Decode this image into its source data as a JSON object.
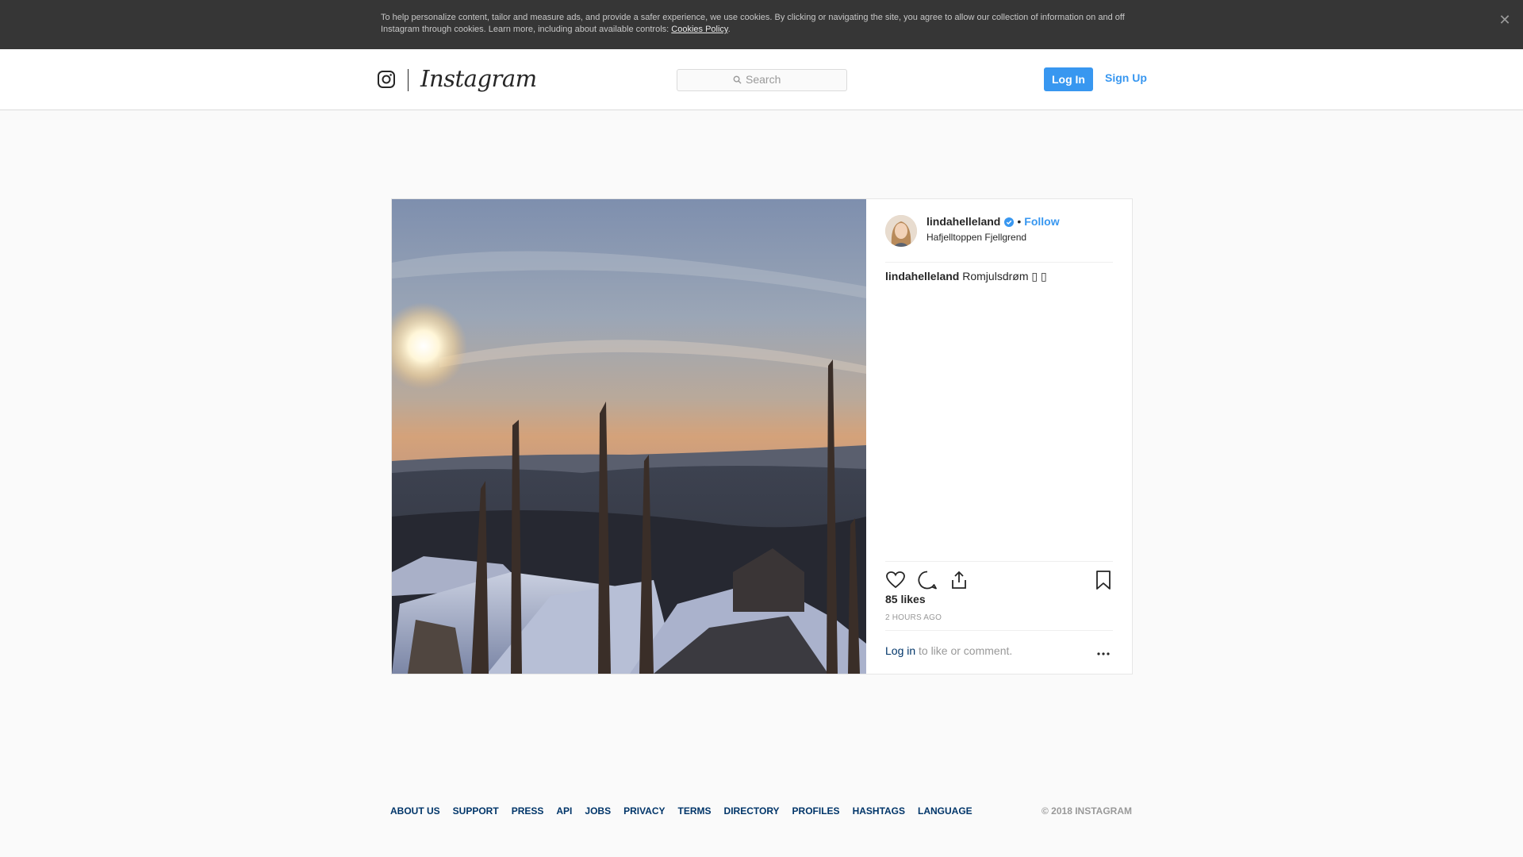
{
  "cookie_banner": {
    "text": "To help personalize content, tailor and measure ads, and provide a safer experience, we use cookies. By clicking or navigating the site, you agree to allow our collection of information on and off Instagram through cookies. Learn more, including about available controls: ",
    "link": "Cookies Policy",
    "end": ".",
    "close_icon": "close-icon"
  },
  "header": {
    "logo_text": "Instagram",
    "search_placeholder": "Search",
    "login_label": "Log In",
    "signup_label": "Sign Up"
  },
  "post": {
    "username": "lindahelleland",
    "verified": true,
    "separator": "•",
    "follow_label": "Follow",
    "location": "Hafjelltoppen Fjellgrend",
    "caption_user": "lindahelleland",
    "caption_text": "Romjulsdrøm ▯ ▯",
    "likes": "85 likes",
    "time": "2 HOURS AGO",
    "login_link": "Log in",
    "login_rest": "to like or comment.",
    "icons": [
      "heart-icon",
      "comment-icon",
      "share-icon",
      "bookmark-icon",
      "more-icon"
    ]
  },
  "footer": {
    "links": [
      "ABOUT US",
      "SUPPORT",
      "PRESS",
      "API",
      "JOBS",
      "PRIVACY",
      "TERMS",
      "DIRECTORY",
      "PROFILES",
      "HASHTAGS",
      "LANGUAGE"
    ],
    "copyright": "© 2018 INSTAGRAM"
  },
  "colors": {
    "accent": "#3897f0",
    "link_dark": "#003569",
    "banner_bg": "#363636"
  }
}
